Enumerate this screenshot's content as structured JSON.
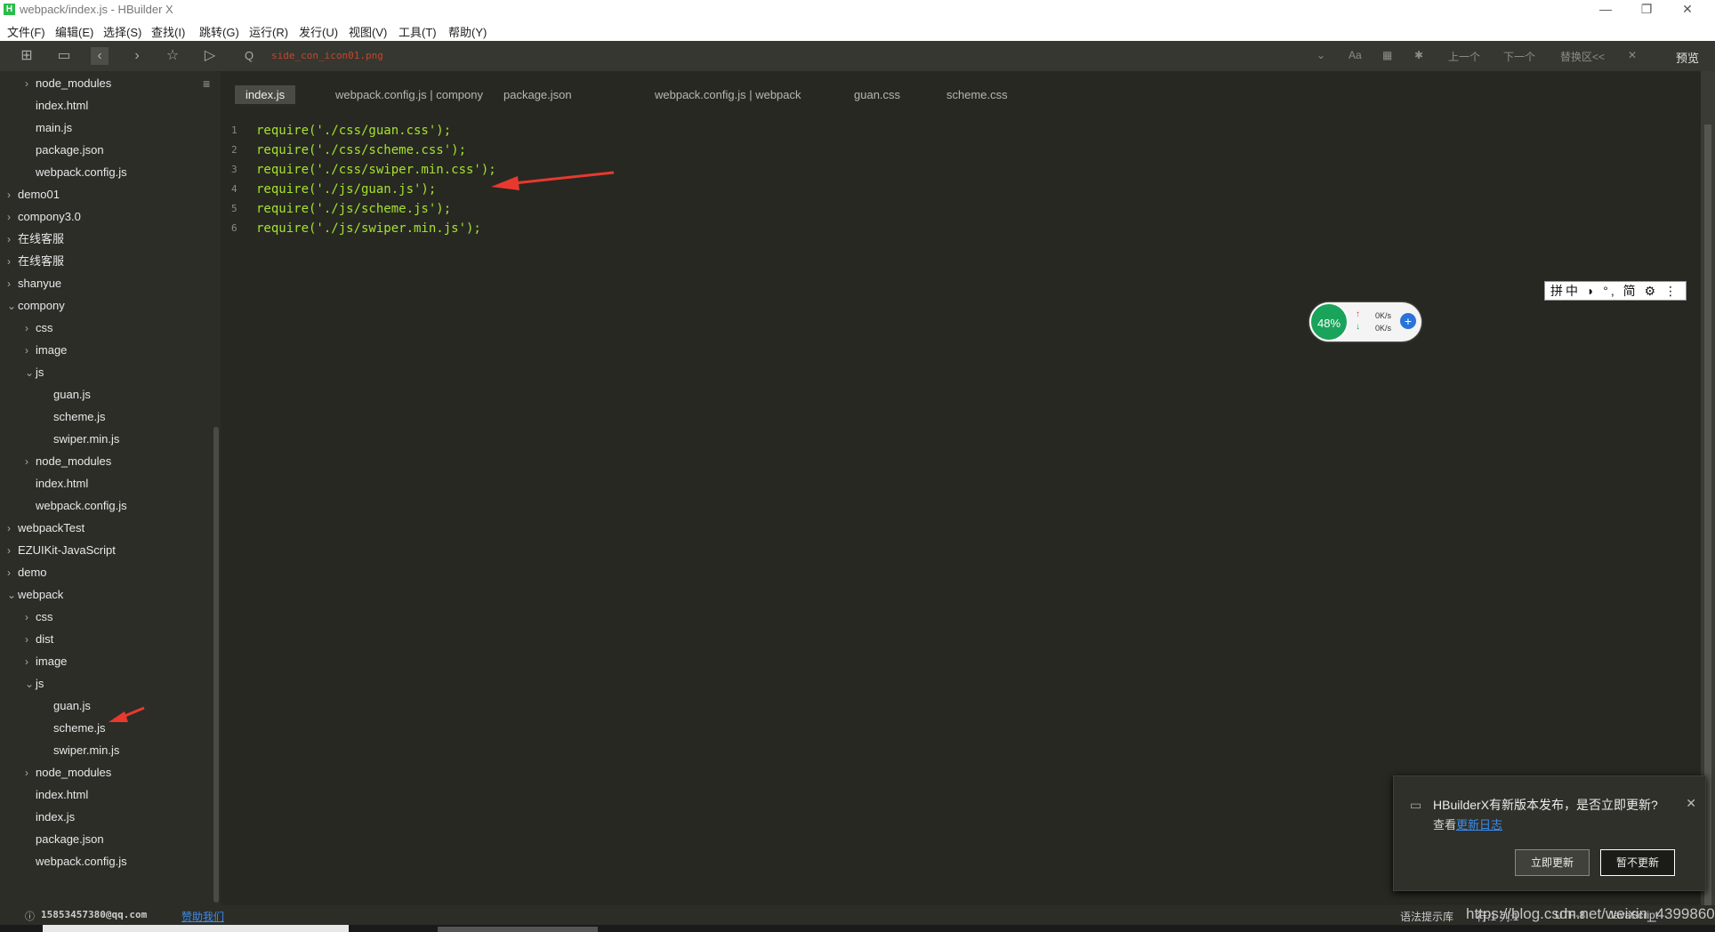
{
  "window": {
    "app_icon": "H",
    "title": "webpack/index.js - HBuilder X",
    "controls": [
      "—",
      "❐",
      "✕"
    ]
  },
  "menu": [
    "文件(F)",
    "编辑(E)",
    "选择(S)",
    "查找(I)",
    "跳转(G)",
    "运行(R)",
    "发行(U)",
    "视图(V)",
    "工具(T)",
    "帮助(Y)"
  ],
  "toolbar": {
    "search_value": "side_con_icon01.png",
    "search_icon_glyph": "Q",
    "case_label": "Aa",
    "prev_label": "上一个",
    "next_label": "下一个",
    "replace_label": "替换区<<",
    "preview_label": "预览"
  },
  "sidebar": {
    "items": [
      {
        "label": "node_modules",
        "chev": "›",
        "indent": 1
      },
      {
        "label": "index.html",
        "chev": "",
        "indent": 1
      },
      {
        "label": "main.js",
        "chev": "",
        "indent": 1
      },
      {
        "label": "package.json",
        "chev": "",
        "indent": 1
      },
      {
        "label": "webpack.config.js",
        "chev": "",
        "indent": 1
      },
      {
        "label": "demo01",
        "chev": "›",
        "indent": 0
      },
      {
        "label": "compony3.0",
        "chev": "›",
        "indent": 0
      },
      {
        "label": "在线客服",
        "chev": "›",
        "indent": 0
      },
      {
        "label": "在线客服",
        "chev": "›",
        "indent": 0
      },
      {
        "label": "shanyue",
        "chev": "›",
        "indent": 0
      },
      {
        "label": "compony",
        "chev": "⌄",
        "indent": 0
      },
      {
        "label": "css",
        "chev": "›",
        "indent": 1
      },
      {
        "label": "image",
        "chev": "›",
        "indent": 1
      },
      {
        "label": "js",
        "chev": "⌄",
        "indent": 1
      },
      {
        "label": "guan.js",
        "chev": "",
        "indent": 2
      },
      {
        "label": "scheme.js",
        "chev": "",
        "indent": 2
      },
      {
        "label": "swiper.min.js",
        "chev": "",
        "indent": 2
      },
      {
        "label": "node_modules",
        "chev": "›",
        "indent": 1
      },
      {
        "label": "index.html",
        "chev": "",
        "indent": 1
      },
      {
        "label": "webpack.config.js",
        "chev": "",
        "indent": 1
      },
      {
        "label": "webpackTest",
        "chev": "›",
        "indent": 0
      },
      {
        "label": "EZUIKit-JavaScript",
        "chev": "›",
        "indent": 0
      },
      {
        "label": "demo",
        "chev": "›",
        "indent": 0
      },
      {
        "label": "webpack",
        "chev": "⌄",
        "indent": 0
      },
      {
        "label": "css",
        "chev": "›",
        "indent": 1
      },
      {
        "label": "dist",
        "chev": "›",
        "indent": 1
      },
      {
        "label": "image",
        "chev": "›",
        "indent": 1
      },
      {
        "label": "js",
        "chev": "⌄",
        "indent": 1
      },
      {
        "label": "guan.js",
        "chev": "",
        "indent": 2
      },
      {
        "label": "scheme.js",
        "chev": "",
        "indent": 2
      },
      {
        "label": "swiper.min.js",
        "chev": "",
        "indent": 2
      },
      {
        "label": "node_modules",
        "chev": "›",
        "indent": 1
      },
      {
        "label": "index.html",
        "chev": "",
        "indent": 1
      },
      {
        "label": "index.js",
        "chev": "",
        "indent": 1
      },
      {
        "label": "package.json",
        "chev": "",
        "indent": 1
      },
      {
        "label": "webpack.config.js",
        "chev": "",
        "indent": 1
      }
    ]
  },
  "tabs": [
    {
      "label": "index.js",
      "active": true
    },
    {
      "label": "webpack.config.js | compony",
      "active": false
    },
    {
      "label": "package.json",
      "active": false
    },
    {
      "label": "webpack.config.js | webpack",
      "active": false
    },
    {
      "label": "guan.css",
      "active": false
    },
    {
      "label": "scheme.css",
      "active": false
    }
  ],
  "code": [
    {
      "n": "1",
      "text": "require('./css/guan.css');"
    },
    {
      "n": "2",
      "text": "require('./css/scheme.css');"
    },
    {
      "n": "3",
      "text": "require('./css/swiper.min.css');"
    },
    {
      "n": "4",
      "text": "require('./js/guan.js');"
    },
    {
      "n": "5",
      "text": "require('./js/scheme.js');"
    },
    {
      "n": "6",
      "text": "require('./js/swiper.min.js');"
    }
  ],
  "ime": {
    "text": "拼中 ◗ °, 简 ⚙ ⋮"
  },
  "net_widget": {
    "percent": "48%",
    "up": "0K/s",
    "down": "0K/s"
  },
  "notification": {
    "message": "HBuilderX有新版本发布，是否立即更新?",
    "sub_prefix": "查看",
    "sub_link": "更新日志",
    "update_now": "立即更新",
    "not_now": "暂不更新"
  },
  "status": {
    "user": "15853457380@qq.com",
    "sponsor": "赞助我们",
    "syntax": "语法提示库",
    "position": "行:1 列:1",
    "encoding": "UTF-8",
    "language": "JavaScript"
  },
  "watermark": "https://blog.csdn.net/weixin_43998604",
  "colors": {
    "editor_bg": "#272822",
    "code": "#a6e22e",
    "accent_link": "#3b8cf2",
    "arrow": "#e8392f"
  }
}
